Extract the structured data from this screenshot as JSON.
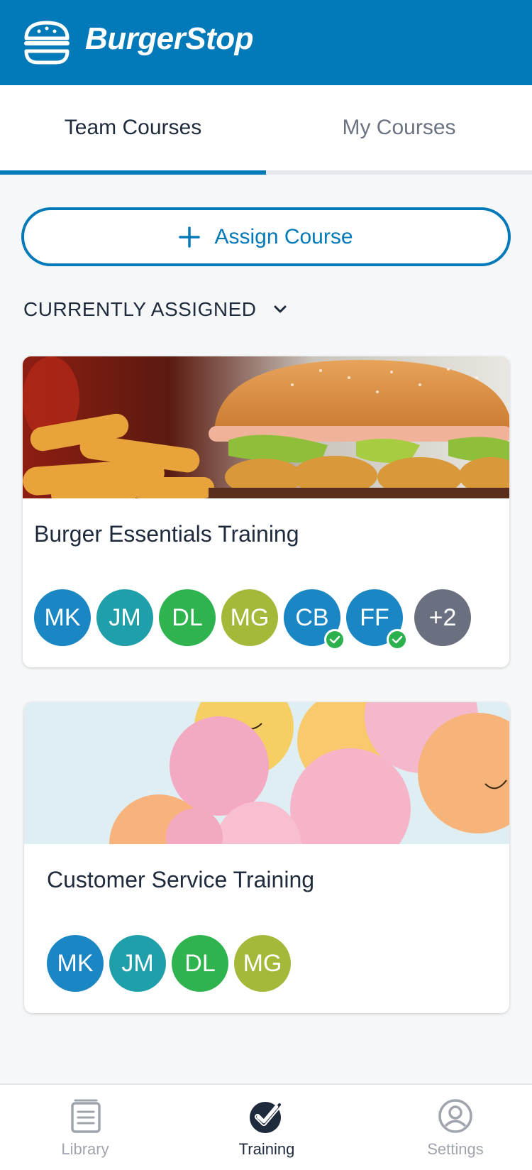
{
  "app": {
    "brand": "BurgerStop",
    "brand_color": "#0279b8"
  },
  "tabs": [
    {
      "label": "Team Courses",
      "active": true
    },
    {
      "label": "My Courses",
      "active": false
    }
  ],
  "assign_button": {
    "label": "Assign Course",
    "icon": "plus-icon"
  },
  "section": {
    "title": "CURRENTLY ASSIGNED",
    "icon": "chevron-down-icon"
  },
  "courses": [
    {
      "title": "Burger Essentials Training",
      "image": "burger-and-fries-photo",
      "assignees": [
        {
          "initials": "MK",
          "color": "#1a86c4",
          "completed": false
        },
        {
          "initials": "JM",
          "color": "#1f9faa",
          "completed": false
        },
        {
          "initials": "DL",
          "color": "#2fb34f",
          "completed": false
        },
        {
          "initials": "MG",
          "color": "#a4b83a",
          "completed": false
        },
        {
          "initials": "CB",
          "color": "#1a86c4",
          "completed": true
        },
        {
          "initials": "FF",
          "color": "#1a86c4",
          "completed": true
        }
      ],
      "overflow": {
        "label": "+2",
        "color": "#6b7080"
      }
    },
    {
      "title": "Customer Service Training",
      "image": "balloons-photo",
      "assignees": [
        {
          "initials": "MK",
          "color": "#1a86c4",
          "completed": false
        },
        {
          "initials": "JM",
          "color": "#1f9faa",
          "completed": false
        },
        {
          "initials": "DL",
          "color": "#2fb34f",
          "completed": false
        },
        {
          "initials": "MG",
          "color": "#a4b83a",
          "completed": false
        }
      ]
    }
  ],
  "bottom_nav": [
    {
      "label": "Library",
      "icon": "library-icon",
      "active": false
    },
    {
      "label": "Training",
      "icon": "check-circle-icon",
      "active": true
    },
    {
      "label": "Settings",
      "icon": "profile-icon",
      "active": false
    }
  ]
}
